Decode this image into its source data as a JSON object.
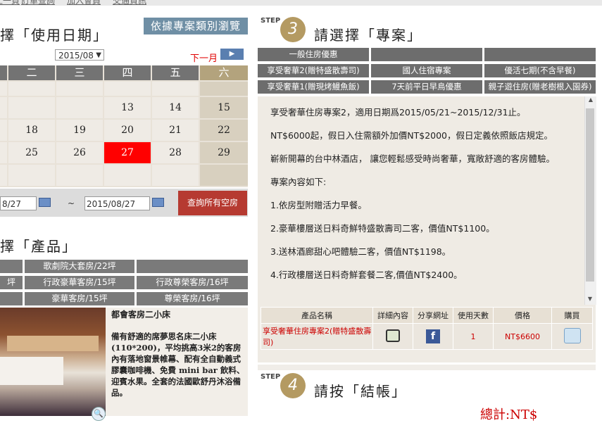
{
  "top_nav": [
    "上一頁",
    "訂單查詢",
    "加入會員",
    "交通資訊"
  ],
  "left": {
    "title_date": "擇「使用日期」",
    "browse_button": "依據專案類別瀏覽",
    "month": "2015/08",
    "next_month": "下一月",
    "weekdays": [
      "二",
      "三",
      "四",
      "五",
      "六"
    ],
    "weeks": [
      [
        "",
        "",
        "",
        "",
        ""
      ],
      [
        "",
        "",
        "13",
        "14",
        "15"
      ],
      [
        "18",
        "19",
        "20",
        "21",
        "22"
      ],
      [
        "25",
        "26",
        "27",
        "28",
        "29"
      ],
      [
        "",
        "",
        "",
        "",
        ""
      ]
    ],
    "selected_day": "27",
    "date_from": "8/27",
    "date_to": "2015/08/27",
    "tilde": "~",
    "search_button": "查詢所有空房",
    "title_product": "擇「產品」",
    "product_rows": [
      [
        "",
        "歌劇院大套房/22坪",
        ""
      ],
      [
        "坪",
        "行政豪華客房/15坪",
        "行政尊榮客房/16坪"
      ],
      [
        "",
        "豪華客房/15坪",
        "尊榮客房/16坪"
      ]
    ],
    "room_title": "都會客房二小床",
    "room_desc": "備有舒適的席夢思名床二小床(110*200)，平均挑高3米2的客房內有落地窗景帷幕、配有全自動義式膠囊咖啡機、免費 mini bar 飲料、迎賓水果。全套的法國歐舒丹沐浴備品。"
  },
  "step3": {
    "step_word": "STEP",
    "step_num": "3",
    "title": "請選擇「專案」",
    "tabs": [
      [
        "一般住房優惠",
        "",
        ""
      ],
      [
        "享受奢華2(贈特盛散壽司)",
        "國人住宿專案",
        "優活七期(不含早餐)"
      ],
      [
        "享受奢華1(贈現烤鰻魚飯)",
        "7天前平日早鳥優惠",
        "親子遊住房(贈老樹根入園券)"
      ]
    ],
    "paragraphs": [
      "享受奢華住房專案2，適用日期爲2015/05/21~2015/12/31止。",
      "NT$6000起，假日入住需額外加價NT$2000，假日定義依照飯店規定。",
      " 嶄新開幕的台中林酒店， 讓您輕鬆感受時尚奢華，寬敞舒適的客房體驗。",
      "專案內容如下:",
      "1.依房型附贈活力早餐。",
      "2.豪華樓層送日料奇鮮特盛散壽司二客，價值NT$1100。",
      "3.送林酒廊甜心吧體驗二客，價值NT$1198。",
      "4.行政樓層送日料奇鮮套餐二客,價值NT$2400。"
    ],
    "table": {
      "headers": [
        "產品名稱",
        "詳細內容",
        "分享網址",
        "使用天數",
        "價格",
        "購買"
      ],
      "row": {
        "name": "享受奢華住房專案2(贈特盛散壽司)",
        "days": "1",
        "price": "NT$6600"
      }
    }
  },
  "step4": {
    "step_word": "STEP",
    "step_num": "4",
    "title": "請按「結帳」",
    "total_label": "總計:NT$"
  }
}
